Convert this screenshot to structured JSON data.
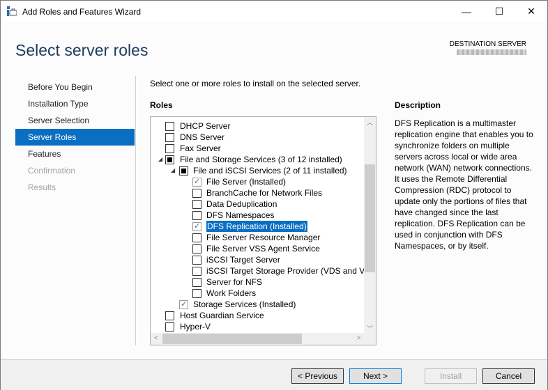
{
  "window": {
    "title": "Add Roles and Features Wizard",
    "minimize": "—",
    "maximize": "☐",
    "close": "✕"
  },
  "header": {
    "title": "Select server roles",
    "destination_label": "DESTINATION SERVER"
  },
  "nav": {
    "items": [
      {
        "label": "Before You Begin",
        "state": "normal"
      },
      {
        "label": "Installation Type",
        "state": "normal"
      },
      {
        "label": "Server Selection",
        "state": "normal"
      },
      {
        "label": "Server Roles",
        "state": "selected"
      },
      {
        "label": "Features",
        "state": "normal"
      },
      {
        "label": "Confirmation",
        "state": "disabled"
      },
      {
        "label": "Results",
        "state": "disabled"
      }
    ]
  },
  "main": {
    "instruction": "Select one or more roles to install on the selected server.",
    "roles_heading": "Roles",
    "roles": [
      {
        "label": "DHCP Server",
        "level": 0,
        "state": "unchecked"
      },
      {
        "label": "DNS Server",
        "level": 0,
        "state": "unchecked"
      },
      {
        "label": "Fax Server",
        "level": 0,
        "state": "unchecked"
      },
      {
        "label": "File and Storage Services (3 of 12 installed)",
        "level": 0,
        "state": "partial",
        "expanded": true
      },
      {
        "label": "File and iSCSI Services (2 of 11 installed)",
        "level": 1,
        "state": "partial",
        "expanded": true
      },
      {
        "label": "File Server (Installed)",
        "level": 2,
        "state": "checked"
      },
      {
        "label": "BranchCache for Network Files",
        "level": 2,
        "state": "unchecked"
      },
      {
        "label": "Data Deduplication",
        "level": 2,
        "state": "unchecked"
      },
      {
        "label": "DFS Namespaces",
        "level": 2,
        "state": "unchecked"
      },
      {
        "label": "DFS Replication (Installed)",
        "level": 2,
        "state": "checked",
        "selected": true
      },
      {
        "label": "File Server Resource Manager",
        "level": 2,
        "state": "unchecked"
      },
      {
        "label": "File Server VSS Agent Service",
        "level": 2,
        "state": "unchecked"
      },
      {
        "label": "iSCSI Target Server",
        "level": 2,
        "state": "unchecked"
      },
      {
        "label": "iSCSI Target Storage Provider (VDS and VSS",
        "level": 2,
        "state": "unchecked"
      },
      {
        "label": "Server for NFS",
        "level": 2,
        "state": "unchecked"
      },
      {
        "label": "Work Folders",
        "level": 2,
        "state": "unchecked"
      },
      {
        "label": "Storage Services (Installed)",
        "level": 1,
        "state": "checked"
      },
      {
        "label": "Host Guardian Service",
        "level": 0,
        "state": "unchecked"
      },
      {
        "label": "Hyper-V",
        "level": 0,
        "state": "unchecked"
      }
    ],
    "description_heading": "Description",
    "description": "DFS Replication is a multimaster replication engine that enables you to synchronize folders on multiple servers across local or wide area network (WAN) network connections. It uses the Remote Differential Compression (RDC) protocol to update only the portions of files that have changed since the last replication. DFS Replication can be used in conjunction with DFS Namespaces, or by itself."
  },
  "footer": {
    "previous": "< Previous",
    "next": "Next >",
    "install": "Install",
    "cancel": "Cancel"
  }
}
